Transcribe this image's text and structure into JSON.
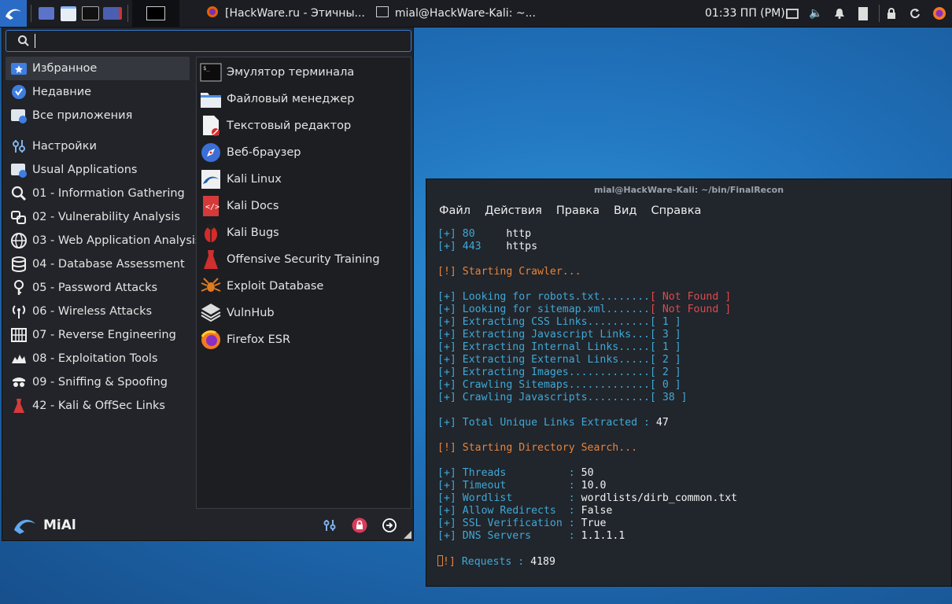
{
  "panel": {
    "tasks": [
      {
        "label": "[HackWare.ru - Этичны...",
        "icon": "firefox-icon"
      },
      {
        "label": "mial@HackWare-Kali: ~...",
        "icon": "terminal-icon"
      }
    ],
    "clock": "01:33 ПП (РМ)"
  },
  "menu": {
    "search_placeholder": "",
    "categories": [
      {
        "label": "Избранное",
        "icon": "favorites-icon"
      },
      {
        "label": "Недавние",
        "icon": "recent-icon"
      },
      {
        "label": "Все приложения",
        "icon": "all-apps-icon"
      },
      {
        "label": "Настройки",
        "icon": "settings-icon"
      },
      {
        "label": "Usual Applications",
        "icon": "usual-apps-icon"
      },
      {
        "label": "01 - Information Gathering",
        "icon": "info-gathering-icon"
      },
      {
        "label": "02 - Vulnerability Analysis",
        "icon": "vuln-analysis-icon"
      },
      {
        "label": "03 - Web Application Analysis",
        "icon": "web-app-icon"
      },
      {
        "label": "04 - Database Assessment",
        "icon": "database-icon"
      },
      {
        "label": "05 - Password Attacks",
        "icon": "password-icon"
      },
      {
        "label": "06 - Wireless Attacks",
        "icon": "wireless-icon"
      },
      {
        "label": "07 - Reverse Engineering",
        "icon": "reverse-eng-icon"
      },
      {
        "label": "08 - Exploitation Tools",
        "icon": "exploit-icon"
      },
      {
        "label": "09 - Sniffing & Spoofing",
        "icon": "sniffing-icon"
      },
      {
        "label": "42 - Kali & OffSec Links",
        "icon": "offsec-links-icon"
      }
    ],
    "apps": [
      {
        "label": "Эмулятор терминала",
        "icon": "terminal-icon"
      },
      {
        "label": "Файловый менеджер",
        "icon": "folder-icon"
      },
      {
        "label": "Текстовый редактор",
        "icon": "text-editor-icon"
      },
      {
        "label": "Веб-браузер",
        "icon": "web-browser-icon"
      },
      {
        "label": "Kali Linux",
        "icon": "kali-linux-icon"
      },
      {
        "label": "Kali Docs",
        "icon": "kali-docs-icon"
      },
      {
        "label": "Kali Bugs",
        "icon": "kali-bugs-icon"
      },
      {
        "label": "Offensive Security Training",
        "icon": "offsec-training-icon"
      },
      {
        "label": "Exploit Database",
        "icon": "exploit-db-icon"
      },
      {
        "label": "VulnHub",
        "icon": "vulnhub-icon"
      },
      {
        "label": "Firefox ESR",
        "icon": "firefox-icon"
      }
    ],
    "user": "MiAl"
  },
  "terminal": {
    "title": "mial@HackWare-Kali: ~/bin/FinalRecon",
    "menu": [
      "Файл",
      "Действия",
      "Правка",
      "Вид",
      "Справка"
    ],
    "lines": [
      [
        [
          "c-cyan",
          "[+] 80     "
        ],
        [
          "c-white",
          "http"
        ]
      ],
      [
        [
          "c-cyan",
          "[+] 443    "
        ],
        [
          "c-white",
          "https"
        ]
      ],
      [],
      [
        [
          "c-orange",
          "[!] Starting Crawler..."
        ]
      ],
      [],
      [
        [
          "c-cyan",
          "[+] Looking for robots.txt........"
        ],
        [
          "c-red",
          "[ Not Found ]"
        ]
      ],
      [
        [
          "c-cyan",
          "[+] Looking for sitemap.xml......."
        ],
        [
          "c-red",
          "[ Not Found ]"
        ]
      ],
      [
        [
          "c-cyan",
          "[+] Extracting CSS Links.........."
        ],
        [
          "c-cyan",
          "[ 1 ]"
        ]
      ],
      [
        [
          "c-cyan",
          "[+] Extracting Javascript Links..."
        ],
        [
          "c-cyan",
          "[ 3 ]"
        ]
      ],
      [
        [
          "c-cyan",
          "[+] Extracting Internal Links....."
        ],
        [
          "c-cyan",
          "[ 1 ]"
        ]
      ],
      [
        [
          "c-cyan",
          "[+] Extracting External Links....."
        ],
        [
          "c-cyan",
          "[ 2 ]"
        ]
      ],
      [
        [
          "c-cyan",
          "[+] Extracting Images............."
        ],
        [
          "c-cyan",
          "[ 2 ]"
        ]
      ],
      [
        [
          "c-cyan",
          "[+] Crawling Sitemaps............."
        ],
        [
          "c-cyan",
          "[ 0 ]"
        ]
      ],
      [
        [
          "c-cyan",
          "[+] Crawling Javascripts.........."
        ],
        [
          "c-cyan",
          "[ 38 ]"
        ]
      ],
      [],
      [
        [
          "c-cyan",
          "[+] Total Unique Links Extracted : "
        ],
        [
          "c-white",
          "47"
        ]
      ],
      [],
      [
        [
          "c-orange",
          "[!] Starting Directory Search..."
        ]
      ],
      [],
      [
        [
          "c-cyan",
          "[+] Threads          : "
        ],
        [
          "c-white",
          "50"
        ]
      ],
      [
        [
          "c-cyan",
          "[+] Timeout          : "
        ],
        [
          "c-white",
          "10.0"
        ]
      ],
      [
        [
          "c-cyan",
          "[+] Wordlist         : "
        ],
        [
          "c-white",
          "wordlists/dirb_common.txt"
        ]
      ],
      [
        [
          "c-cyan",
          "[+] Allow Redirects  : "
        ],
        [
          "c-white",
          "False"
        ]
      ],
      [
        [
          "c-cyan",
          "[+] SSL Verification : "
        ],
        [
          "c-white",
          "True"
        ]
      ],
      [
        [
          "c-cyan",
          "[+] DNS Servers      : "
        ],
        [
          "c-white",
          "1.1.1.1"
        ]
      ],
      [],
      [
        [
          "c-orange",
          "CURSOR!] "
        ],
        [
          "c-cyan",
          "Requests : "
        ],
        [
          "c-white",
          "4189"
        ]
      ]
    ]
  },
  "colors": {
    "accent": "#3a7bd5",
    "kali_blue": "#2a6cc5",
    "desktop_blue": "#1f6fb8",
    "term_bg": "#21252c",
    "menu_bg": "#222429"
  }
}
